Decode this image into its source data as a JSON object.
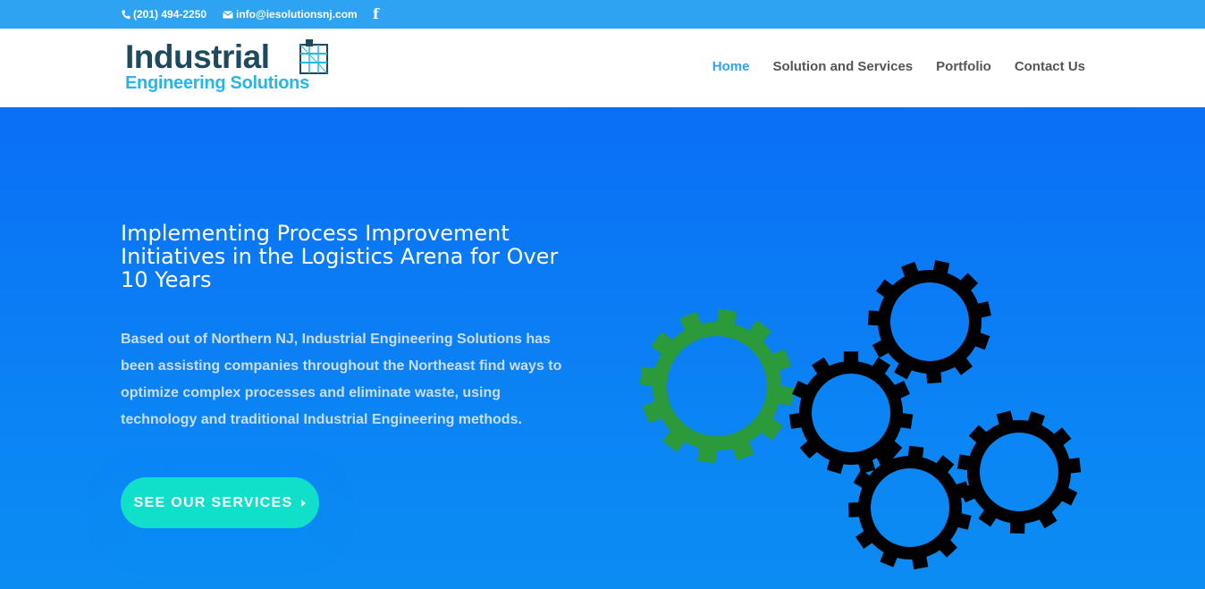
{
  "topbar": {
    "phone": "(201) 494-2250",
    "email": "info@iesolutionsnj.com",
    "facebook_icon": "f"
  },
  "logo": {
    "line1": "Industrial",
    "line2": "Engineering Solutions"
  },
  "nav": {
    "items": [
      {
        "label": "Home",
        "active": true
      },
      {
        "label": "Solution and Services",
        "active": false
      },
      {
        "label": "Portfolio",
        "active": false
      },
      {
        "label": "Contact Us",
        "active": false
      }
    ]
  },
  "hero": {
    "heading": "Implementing Process Improvement Initiatives in the Logistics Arena for Over 10 Years",
    "body": "Based out of Northern NJ, Industrial Engineering Solutions has been assisting companies throughout the Northeast find ways to optimize complex processes and eliminate waste, using technology and traditional Industrial Engineering methods.",
    "cta_label": "SEE OUR SERVICES"
  },
  "colors": {
    "topbar": "#2ea3f2",
    "accent": "#2ea3f2",
    "cta": "#10e0c9",
    "gear_green": "#2a9a3a",
    "gear_black": "#000000"
  },
  "icons": [
    "phone-icon",
    "email-icon",
    "facebook-icon",
    "building-icon",
    "chevron-right-icon",
    "gear-icon"
  ]
}
